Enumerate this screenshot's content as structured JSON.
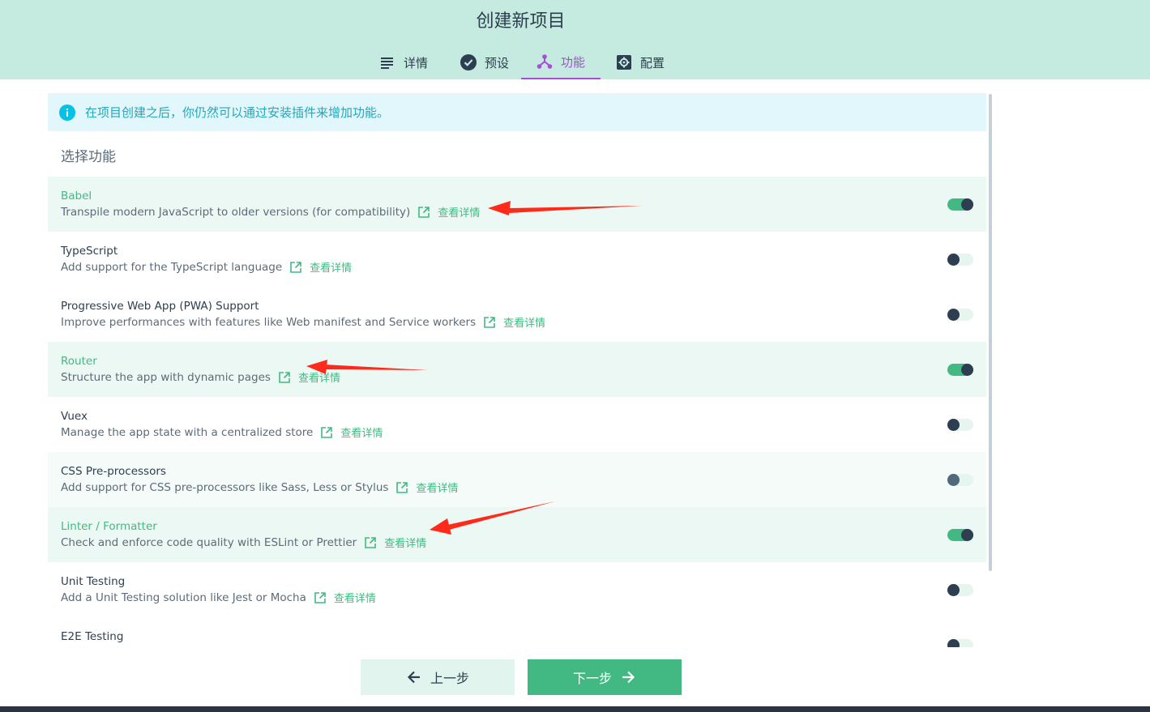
{
  "header": {
    "title": "创建新项目",
    "tabs": [
      {
        "label": "详情",
        "icon": "list-icon",
        "active": false
      },
      {
        "label": "预设",
        "icon": "check-circle-icon",
        "active": false
      },
      {
        "label": "功能",
        "icon": "fork-icon",
        "active": true
      },
      {
        "label": "配置",
        "icon": "gear-icon",
        "active": false
      }
    ]
  },
  "info": {
    "icon": "info-icon",
    "text": "在项目创建之后，你仍然可以通过安装插件来增加功能。"
  },
  "section_title": "选择功能",
  "more_label": "查看详情",
  "features": [
    {
      "name": "Babel",
      "description": "Transpile modern JavaScript to older versions (for compatibility)",
      "enabled": true
    },
    {
      "name": "TypeScript",
      "description": "Add support for the TypeScript language",
      "enabled": false
    },
    {
      "name": "Progressive Web App (PWA) Support",
      "description": "Improve performances with features like Web manifest and Service workers",
      "enabled": false
    },
    {
      "name": "Router",
      "description": "Structure the app with dynamic pages",
      "enabled": true
    },
    {
      "name": "Vuex",
      "description": "Manage the app state with a centralized store",
      "enabled": false
    },
    {
      "name": "CSS Pre-processors",
      "description": "Add support for CSS pre-processors like Sass, Less or Stylus",
      "enabled": false
    },
    {
      "name": "Linter / Formatter",
      "description": "Check and enforce code quality with ESLint or Prettier",
      "enabled": true
    },
    {
      "name": "Unit Testing",
      "description": "Add a Unit Testing solution like Jest or Mocha",
      "enabled": false
    },
    {
      "name": "E2E Testing",
      "description": "",
      "enabled": false
    }
  ],
  "footer": {
    "prev_label": "上一步",
    "next_label": "下一步"
  },
  "colors": {
    "accent": "#42b983",
    "active_tab": "#a94cd7",
    "header_bg": "#c5eadf",
    "info_text": "#27a6b9",
    "annotation_arrow": "#ff2a1a"
  }
}
